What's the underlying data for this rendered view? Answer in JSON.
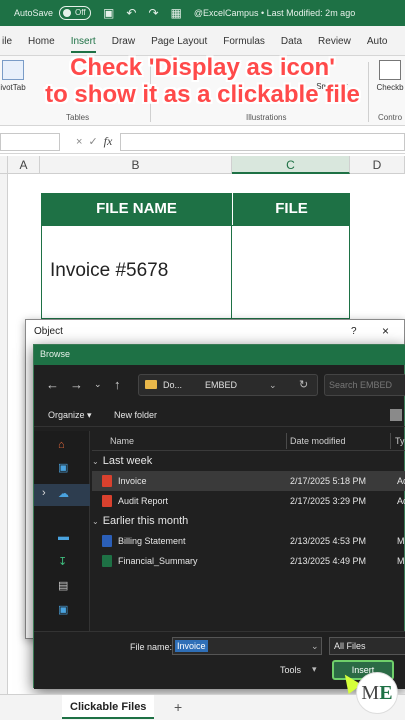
{
  "titlebar": {
    "autosave_label": "AutoSave",
    "autosave_state": "Off",
    "doc_status": "@ExcelCampus • Last Modified: 2m ago"
  },
  "ribbon": {
    "tabs": [
      "ile",
      "Home",
      "Insert",
      "Draw",
      "Page Layout",
      "Formulas",
      "Data",
      "Review",
      "Auto"
    ],
    "active_tab": "Insert",
    "groups": {
      "tables": "Tables",
      "illustrations": "Illustrations",
      "controls": "Contro"
    },
    "buttons": {
      "pivottable": "ivotTab",
      "smartart": "SmartArt",
      "checkbox": "Checkb"
    }
  },
  "caption": {
    "line1": "Check 'Display as icon'",
    "line2": "to show it as a clickable file"
  },
  "formula_bar": {
    "fx": "fx",
    "cancel": "×",
    "confirm": "✓"
  },
  "columns": [
    "A",
    "B",
    "C",
    "D"
  ],
  "table": {
    "header_name": "FILE NAME",
    "header_file": "FILE",
    "row1_name": "Invoice #5678"
  },
  "object_dialog": {
    "title": "Object",
    "help": "?",
    "close": "×"
  },
  "browse_dialog": {
    "title": "Browse",
    "address": {
      "seg1": "Do...",
      "seg2": "EMBED"
    },
    "search_placeholder": "Search EMBED",
    "organize": "Organize",
    "new_folder": "New folder",
    "columns": {
      "name": "Name",
      "date": "Date modified",
      "type": "Ty"
    },
    "groups": {
      "last_week": "Last week",
      "earlier": "Earlier this month"
    },
    "files": [
      {
        "name": "Invoice",
        "date": "2/17/2025 5:18 PM",
        "type": "Ac",
        "icon": "pdf-icon",
        "selected": true
      },
      {
        "name": "Audit Report",
        "date": "2/17/2025 3:29 PM",
        "type": "Ac",
        "icon": "pdf-icon",
        "selected": false
      },
      {
        "name": "Billing Statement",
        "date": "2/13/2025 4:53 PM",
        "type": "M",
        "icon": "word-icon",
        "selected": false
      },
      {
        "name": "Financial_Summary",
        "date": "2/13/2025 4:49 PM",
        "type": "M",
        "icon": "excel-icon",
        "selected": false
      }
    ],
    "file_name_label": "File name:",
    "file_name_value": "Invoice",
    "file_type": "All Files",
    "tools": "Tools",
    "insert": "Insert"
  },
  "sheet_tab": "Clickable Files",
  "colors": {
    "excel_green": "#1e7145",
    "caption_red": "#ff4a4a",
    "dialog_dark": "#202020"
  }
}
